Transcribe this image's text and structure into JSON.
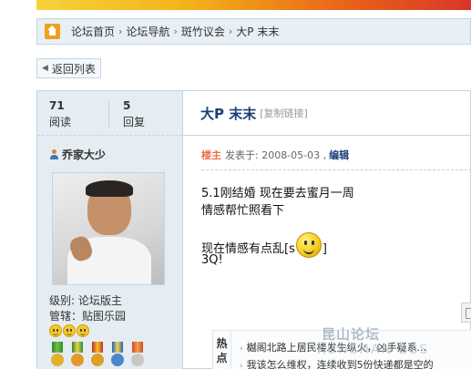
{
  "breadcrumb": {
    "items": [
      "论坛首页",
      "论坛导航",
      "斑竹议会",
      "大P 末末"
    ],
    "separator": "›"
  },
  "back_button": {
    "label": "返回列表"
  },
  "stats": {
    "views": "71",
    "views_label": "阅读",
    "replies": "5",
    "replies_label": "回复"
  },
  "author": {
    "name": "乔家大少",
    "level": "级别: 论坛版主",
    "manage": "管辖：贴图乐园"
  },
  "post": {
    "title": "大P 末末",
    "copy_link": "[复制链接]",
    "floor": "楼主",
    "posted": "发表于: 2008-05-03 ,",
    "edit": "编辑",
    "lines": [
      "5.1刚结婚 现在要去蜜月一周",
      "情感帮忙照看下",
      "现在情感有点乱[s",
      "]",
      "3Q!"
    ]
  },
  "hot": {
    "label_top": "热",
    "label_bottom": "点",
    "items": [
      "樾阁北路上居民楼发生纵火，凶手疑系...",
      "我该怎么维权，连续收到5份快递都是空的"
    ]
  },
  "watermark": {
    "top": "昆山论坛",
    "bottom": "KUNSHAN BBS"
  },
  "colors": {
    "accent": "#1c3f77",
    "border": "#c2d5e3",
    "sidebar_bg": "#e5edf2",
    "floor": "#f26c4f"
  }
}
